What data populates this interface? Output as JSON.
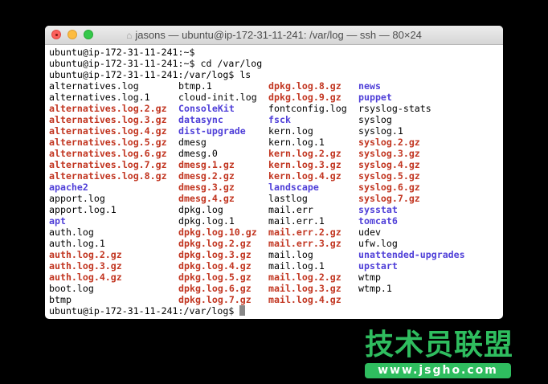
{
  "window": {
    "title": "jasons — ubuntu@ip-172-31-11-241: /var/log — ssh — 80×24"
  },
  "terminal": {
    "lines": [
      "ubuntu@ip-172-31-11-241:~$",
      "ubuntu@ip-172-31-11-241:~$ cd /var/log",
      "ubuntu@ip-172-31-11-241:/var/log$ ls"
    ],
    "listing": [
      [
        {
          "n": "alternatives.log",
          "t": "file"
        },
        {
          "n": "btmp.1",
          "t": "file"
        },
        {
          "n": "dpkg.log.8.gz",
          "t": "gz"
        },
        {
          "n": "news",
          "t": "dir"
        }
      ],
      [
        {
          "n": "alternatives.log.1",
          "t": "file"
        },
        {
          "n": "cloud-init.log",
          "t": "file"
        },
        {
          "n": "dpkg.log.9.gz",
          "t": "gz"
        },
        {
          "n": "puppet",
          "t": "dir"
        }
      ],
      [
        {
          "n": "alternatives.log.2.gz",
          "t": "gz"
        },
        {
          "n": "ConsoleKit",
          "t": "dir"
        },
        {
          "n": "fontconfig.log",
          "t": "file"
        },
        {
          "n": "rsyslog-stats",
          "t": "file"
        }
      ],
      [
        {
          "n": "alternatives.log.3.gz",
          "t": "gz"
        },
        {
          "n": "datasync",
          "t": "dir"
        },
        {
          "n": "fsck",
          "t": "dir"
        },
        {
          "n": "syslog",
          "t": "file"
        }
      ],
      [
        {
          "n": "alternatives.log.4.gz",
          "t": "gz"
        },
        {
          "n": "dist-upgrade",
          "t": "dir"
        },
        {
          "n": "kern.log",
          "t": "file"
        },
        {
          "n": "syslog.1",
          "t": "file"
        }
      ],
      [
        {
          "n": "alternatives.log.5.gz",
          "t": "gz"
        },
        {
          "n": "dmesg",
          "t": "file"
        },
        {
          "n": "kern.log.1",
          "t": "file"
        },
        {
          "n": "syslog.2.gz",
          "t": "gz"
        }
      ],
      [
        {
          "n": "alternatives.log.6.gz",
          "t": "gz"
        },
        {
          "n": "dmesg.0",
          "t": "file"
        },
        {
          "n": "kern.log.2.gz",
          "t": "gz"
        },
        {
          "n": "syslog.3.gz",
          "t": "gz"
        }
      ],
      [
        {
          "n": "alternatives.log.7.gz",
          "t": "gz"
        },
        {
          "n": "dmesg.1.gz",
          "t": "gz"
        },
        {
          "n": "kern.log.3.gz",
          "t": "gz"
        },
        {
          "n": "syslog.4.gz",
          "t": "gz"
        }
      ],
      [
        {
          "n": "alternatives.log.8.gz",
          "t": "gz"
        },
        {
          "n": "dmesg.2.gz",
          "t": "gz"
        },
        {
          "n": "kern.log.4.gz",
          "t": "gz"
        },
        {
          "n": "syslog.5.gz",
          "t": "gz"
        }
      ],
      [
        {
          "n": "apache2",
          "t": "dir"
        },
        {
          "n": "dmesg.3.gz",
          "t": "gz"
        },
        {
          "n": "landscape",
          "t": "dir"
        },
        {
          "n": "syslog.6.gz",
          "t": "gz"
        }
      ],
      [
        {
          "n": "apport.log",
          "t": "file"
        },
        {
          "n": "dmesg.4.gz",
          "t": "gz"
        },
        {
          "n": "lastlog",
          "t": "file"
        },
        {
          "n": "syslog.7.gz",
          "t": "gz"
        }
      ],
      [
        {
          "n": "apport.log.1",
          "t": "file"
        },
        {
          "n": "dpkg.log",
          "t": "file"
        },
        {
          "n": "mail.err",
          "t": "file"
        },
        {
          "n": "sysstat",
          "t": "dir"
        }
      ],
      [
        {
          "n": "apt",
          "t": "dir"
        },
        {
          "n": "dpkg.log.1",
          "t": "file"
        },
        {
          "n": "mail.err.1",
          "t": "file"
        },
        {
          "n": "tomcat6",
          "t": "dir"
        }
      ],
      [
        {
          "n": "auth.log",
          "t": "file"
        },
        {
          "n": "dpkg.log.10.gz",
          "t": "gz"
        },
        {
          "n": "mail.err.2.gz",
          "t": "gz"
        },
        {
          "n": "udev",
          "t": "file"
        }
      ],
      [
        {
          "n": "auth.log.1",
          "t": "file"
        },
        {
          "n": "dpkg.log.2.gz",
          "t": "gz"
        },
        {
          "n": "mail.err.3.gz",
          "t": "gz"
        },
        {
          "n": "ufw.log",
          "t": "file"
        }
      ],
      [
        {
          "n": "auth.log.2.gz",
          "t": "gz"
        },
        {
          "n": "dpkg.log.3.gz",
          "t": "gz"
        },
        {
          "n": "mail.log",
          "t": "file"
        },
        {
          "n": "unattended-upgrades",
          "t": "dir"
        }
      ],
      [
        {
          "n": "auth.log.3.gz",
          "t": "gz"
        },
        {
          "n": "dpkg.log.4.gz",
          "t": "gz"
        },
        {
          "n": "mail.log.1",
          "t": "file"
        },
        {
          "n": "upstart",
          "t": "dir"
        }
      ],
      [
        {
          "n": "auth.log.4.gz",
          "t": "gz"
        },
        {
          "n": "dpkg.log.5.gz",
          "t": "gz"
        },
        {
          "n": "mail.log.2.gz",
          "t": "gz"
        },
        {
          "n": "wtmp",
          "t": "file"
        }
      ],
      [
        {
          "n": "boot.log",
          "t": "file"
        },
        {
          "n": "dpkg.log.6.gz",
          "t": "gz"
        },
        {
          "n": "mail.log.3.gz",
          "t": "gz"
        },
        {
          "n": "wtmp.1",
          "t": "file"
        }
      ],
      [
        {
          "n": "btmp",
          "t": "file"
        },
        {
          "n": "dpkg.log.7.gz",
          "t": "gz"
        },
        {
          "n": "mail.log.4.gz",
          "t": "gz"
        }
      ]
    ],
    "prompt": "ubuntu@ip-172-31-11-241:/var/log$ "
  },
  "colors": {
    "archive": "#c23621",
    "directory": "#4f3fd8",
    "watermark": "#2fbd5f"
  },
  "watermark": {
    "name": "技术员联盟",
    "url": "www.jsgho.com"
  }
}
